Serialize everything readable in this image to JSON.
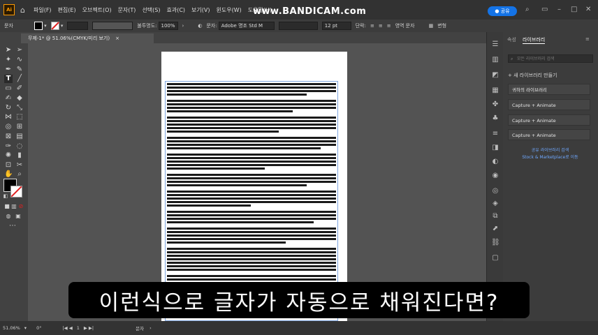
{
  "app": {
    "logo": "Ai",
    "watermark": "www.BANDICAM.com",
    "share_label": "공유"
  },
  "menu": [
    "파일(F)",
    "편집(E)",
    "오브젝트(O)",
    "문자(T)",
    "선택(S)",
    "효과(C)",
    "보기(V)",
    "윈도우(W)",
    "도움말(H)"
  ],
  "control": {
    "mode_label": "문자",
    "opacity_label": "불투명도:",
    "opacity_value": "100%",
    "char_label": "문자:",
    "font_name": "Adobe 명조 Std M",
    "font_size": "12 pt",
    "para_label": "단락:",
    "more_label": "영역 문자",
    "transform_label": "변형"
  },
  "document": {
    "tab_title": "무제-1* @ 51.06%(CMYK/미리 보기)",
    "close": "×"
  },
  "right_panel": {
    "tab_properties": "속성",
    "tab_libraries": "라이브러리",
    "search_placeholder": "모든 라이브러리 검색",
    "new_library": "+ 새 라이브러리 만들기",
    "libraries": [
      "귀하의 라이브러리",
      "Capture + Animate",
      "Capture + Animate",
      "Capture + Animate"
    ],
    "footer_line1": "공유 라이브러리 검색",
    "footer_line2": "Stock & Marketplace로 이동"
  },
  "status": {
    "zoom": "51.06%",
    "rotation": "0°",
    "artboard": "1",
    "tool": "문자"
  },
  "subtitle": "이런식으로 글자가 자동으로 채워진다면?",
  "colors": {
    "menubar": "#323232",
    "canvas": "#535353",
    "accent": "#1473e6",
    "selection": "#7fa6e0"
  }
}
